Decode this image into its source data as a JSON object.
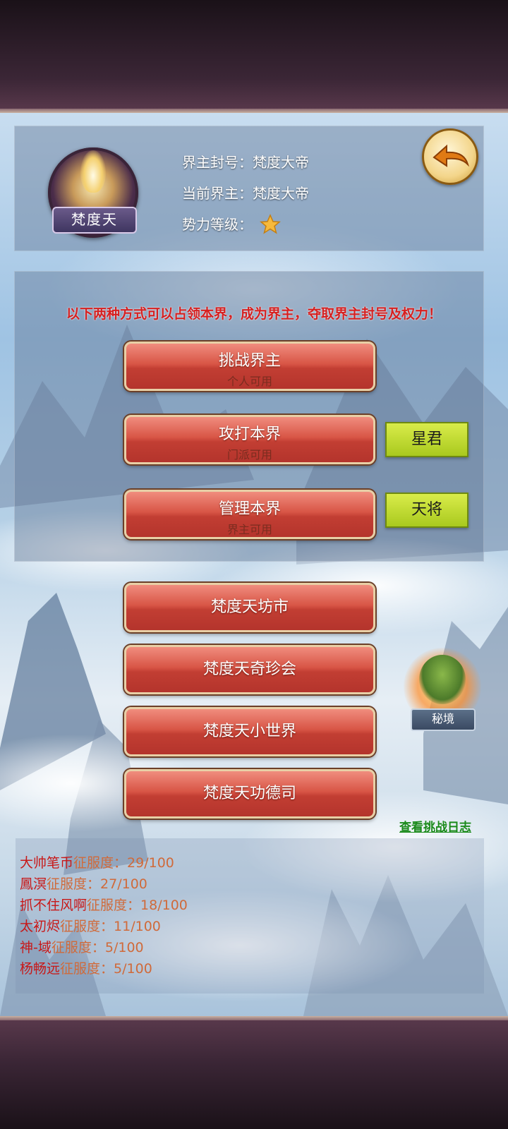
{
  "realm": {
    "emblem_label": "梵度天",
    "title_line": "界主封号：梵度大帝",
    "ruler_line": "当前界主：梵度大帝",
    "level_label": "势力等级："
  },
  "notice": "以下两种方式可以占领本界，成为界主，夺取界主封号及权力！",
  "actions": [
    {
      "label": "挑战界主",
      "sub": "个人可用"
    },
    {
      "label": "攻打本界",
      "sub": "门派可用"
    },
    {
      "label": "管理本界",
      "sub": "界主可用"
    }
  ],
  "side_buttons": {
    "star_lord": "星君",
    "heavenly_general": "天将"
  },
  "menu": [
    "梵度天坊市",
    "梵度天奇珍会",
    "梵度天小世界",
    "梵度天功德司"
  ],
  "secret_realm_label": "秘境",
  "log_link": "查看挑战日志",
  "conquest_list": [
    {
      "name": "大帅笔币",
      "label": "征服度：",
      "value": "29/100"
    },
    {
      "name": "鳳溟",
      "label": "征服度：",
      "value": "27/100"
    },
    {
      "name": "抓不住风啊",
      "label": "征服度：",
      "value": "18/100"
    },
    {
      "name": "太初烬",
      "label": "征服度：",
      "value": "11/100"
    },
    {
      "name": "神-域",
      "label": "征服度：",
      "value": "5/100"
    },
    {
      "name": "杨畅远",
      "label": "征服度：",
      "value": "5/100"
    }
  ],
  "colors": {
    "accent_red": "#d62020",
    "button_red": "#c23e33",
    "button_green": "#a9c91e",
    "link_green": "#1a8a1a"
  },
  "icons": {
    "back": "back-arrow-icon",
    "level": "star-icon"
  }
}
